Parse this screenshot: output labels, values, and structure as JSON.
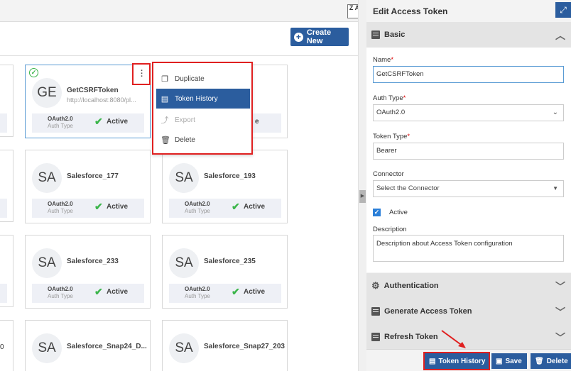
{
  "toolbar": {
    "sort_icon": "Z A",
    "create_label": "Create New"
  },
  "cards": [
    {
      "initials": "GE",
      "name": "GetCSRFToken",
      "url": "http://localhost:8080/pl...",
      "auth": "OAuth2.0",
      "auth_label": "Auth Type",
      "status": "Active"
    },
    {
      "initials": "SA",
      "name": "Salesforce_177",
      "auth": "OAuth2.0",
      "auth_label": "Auth Type",
      "status": "Active"
    },
    {
      "initials": "SA",
      "name": "Salesforce_193",
      "auth": "OAuth2.0",
      "auth_label": "Auth Type",
      "status": "Active"
    },
    {
      "initials": "SA",
      "name": "Salesforce_233",
      "auth": "OAuth2.0",
      "auth_label": "Auth Type",
      "status": "Active"
    },
    {
      "initials": "SA",
      "name": "Salesforce_235",
      "auth": "OAuth2.0",
      "auth_label": "Auth Type",
      "status": "Active"
    },
    {
      "initials": "SA",
      "name": "Salesforce_Snap24_D..."
    },
    {
      "initials": "SA",
      "name": "Salesforce_Snap27_203"
    }
  ],
  "partial_text": {
    "row1_right": "e",
    "row4_left": "0"
  },
  "context_menu": [
    {
      "label": "Duplicate",
      "icon": "duplicate-icon"
    },
    {
      "label": "Token History",
      "icon": "history-icon"
    },
    {
      "label": "Export",
      "icon": "export-icon"
    },
    {
      "label": "Delete",
      "icon": "trash-icon"
    }
  ],
  "panel": {
    "title": "Edit Access Token",
    "sections": {
      "basic": "Basic",
      "authentication": "Authentication",
      "generate": "Generate Access Token",
      "refresh": "Refresh Token"
    },
    "fields": {
      "name_label": "Name",
      "name_value": "GetCSRFToken",
      "auth_type_label": "Auth Type",
      "auth_type_value": "OAuth2.0",
      "token_type_label": "Token Type",
      "token_type_value": "Bearer",
      "connector_label": "Connector",
      "connector_placeholder": "Select the Connector",
      "active_label": "Active",
      "description_label": "Description",
      "description_value": "Description about Access Token configuration"
    }
  },
  "footer": {
    "history": "Token History",
    "save": "Save",
    "delete": "Delete"
  },
  "colors": {
    "accent": "#2b5d9e",
    "highlight": "#e02020",
    "active_green": "#3bb54a"
  }
}
